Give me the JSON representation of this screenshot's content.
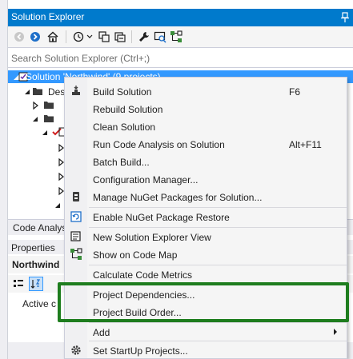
{
  "colors": {
    "accent": "#007acc",
    "selection": "#3399ff",
    "highlight": "#1e7d1e",
    "error_check": "#d02020"
  },
  "solution_explorer": {
    "title": "Solution Explorer",
    "search_placeholder": "Search Solution Explorer (Ctrl+;)",
    "toolbar_icons": [
      "back-icon",
      "forward-icon",
      "home-icon",
      "history-icon",
      "sync-icon",
      "properties-wrench-icon",
      "preview-icon",
      "code-map-icon"
    ]
  },
  "tree": {
    "selected_item": "Solution 'Northwind' (9 projects)",
    "child_partial": "Des"
  },
  "tab_strip": {
    "label": "Code Analys"
  },
  "properties": {
    "header": "Properties",
    "object": "Northwind",
    "row_partial": "Active c"
  },
  "context_menu": {
    "items": [
      {
        "label": "Build Solution",
        "shortcut": "F6",
        "icon": "build-icon"
      },
      {
        "label": "Rebuild Solution",
        "shortcut": "",
        "icon": ""
      },
      {
        "label": "Clean Solution",
        "shortcut": "",
        "icon": ""
      },
      {
        "label": "Run Code Analysis on Solution",
        "shortcut": "Alt+F11",
        "icon": ""
      },
      {
        "label": "Batch Build...",
        "shortcut": "",
        "icon": ""
      },
      {
        "label": "Configuration Manager...",
        "shortcut": "",
        "icon": ""
      },
      {
        "label": "Manage NuGet Packages for Solution...",
        "shortcut": "",
        "icon": "nuget-icon"
      },
      {
        "label": "Enable NuGet Package Restore",
        "shortcut": "",
        "icon": "package-restore-icon"
      },
      {
        "label": "New Solution Explorer View",
        "shortcut": "",
        "icon": "new-view-icon"
      },
      {
        "label": "Show on Code Map",
        "shortcut": "",
        "icon": "code-map-icon"
      },
      {
        "label": "Calculate Code Metrics",
        "shortcut": "",
        "icon": ""
      },
      {
        "label": "Project Dependencies...",
        "shortcut": "",
        "icon": ""
      },
      {
        "label": "Project Build Order...",
        "shortcut": "",
        "icon": ""
      },
      {
        "label": "Add",
        "shortcut": "",
        "icon": ""
      },
      {
        "label": "Set StartUp Projects...",
        "shortcut": "",
        "icon": "gear-icon"
      }
    ]
  }
}
